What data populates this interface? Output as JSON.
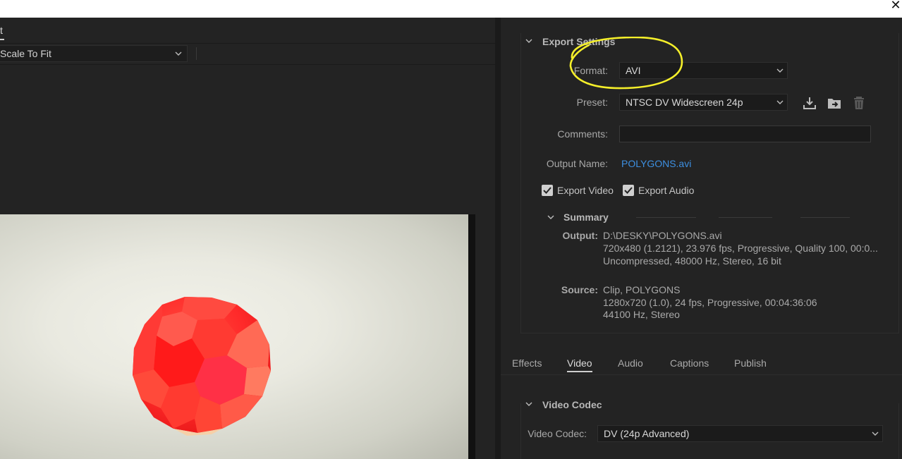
{
  "left_panel": {
    "tab_label": "t",
    "scale_select": "Scale To Fit"
  },
  "export_settings": {
    "section_title": "Export Settings",
    "format_label": "Format:",
    "format_value": "AVI",
    "preset_label": "Preset:",
    "preset_value": "NTSC DV Widescreen 24p",
    "comments_label": "Comments:",
    "comments_value": "",
    "output_name_label": "Output Name:",
    "output_name_value": "POLYGONS.avi",
    "export_video_label": "Export Video",
    "export_audio_label": "Export Audio",
    "export_video_checked": true,
    "export_audio_checked": true
  },
  "summary": {
    "title": "Summary",
    "output_key": "Output:",
    "output_lines": [
      "D:\\DESKY\\POLYGONS.avi",
      "720x480 (1.2121), 23.976 fps, Progressive, Quality 100, 00:0...",
      "Uncompressed, 48000 Hz, Stereo, 16 bit"
    ],
    "source_key": "Source:",
    "source_lines": [
      "Clip, POLYGONS",
      "1280x720 (1.0), 24 fps, Progressive, 00:04:36:06",
      "44100 Hz, Stereo"
    ]
  },
  "tabs": [
    {
      "label": "Effects",
      "active": false
    },
    {
      "label": "Video",
      "active": true
    },
    {
      "label": "Audio",
      "active": false
    },
    {
      "label": "Captions",
      "active": false
    },
    {
      "label": "Publish",
      "active": false
    }
  ],
  "video_codec": {
    "section_title": "Video Codec",
    "codec_label": "Video Codec:",
    "codec_value": "DV (24p Advanced)"
  },
  "colors": {
    "panel_bg": "#232323",
    "link": "#3d8fe0",
    "annotation": "#f5ef2a",
    "ball_red": "#ff2a2a"
  },
  "icons": {
    "close": "close-icon",
    "save_preset": "save-preset-icon",
    "import_preset": "import-preset-icon",
    "delete_preset": "trash-icon"
  }
}
